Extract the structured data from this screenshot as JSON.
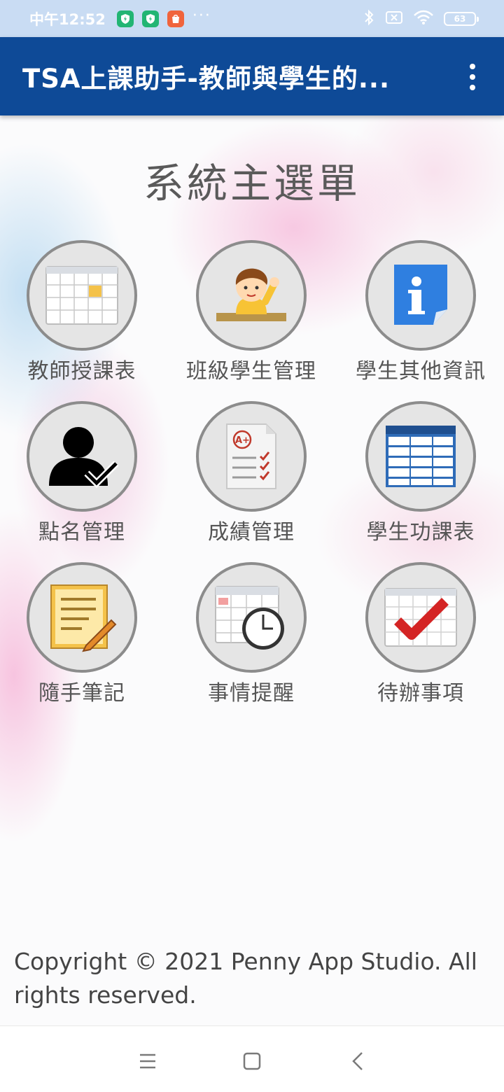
{
  "status_bar": {
    "time": "中午12:52",
    "battery": "63",
    "more": "···"
  },
  "app_bar": {
    "title": "TSA上課助手-教師與學生的..."
  },
  "main": {
    "title": "系統主選單",
    "items": [
      {
        "label": "教師授課表",
        "icon": "calendar-icon"
      },
      {
        "label": "班級學生管理",
        "icon": "student-icon"
      },
      {
        "label": "學生其他資訊",
        "icon": "info-icon"
      },
      {
        "label": "點名管理",
        "icon": "attendance-icon"
      },
      {
        "label": "成績管理",
        "icon": "grades-icon"
      },
      {
        "label": "學生功課表",
        "icon": "table-icon"
      },
      {
        "label": "隨手筆記",
        "icon": "notes-icon"
      },
      {
        "label": "事情提醒",
        "icon": "reminder-clock-icon"
      },
      {
        "label": "待辦事項",
        "icon": "todo-check-icon"
      }
    ]
  },
  "footer": {
    "copyright": "Copyright © 2021 Penny App Studio. All rights reserved."
  },
  "colors": {
    "app_bar": "#0e4a97",
    "status_bar": "#c9dcf3"
  }
}
